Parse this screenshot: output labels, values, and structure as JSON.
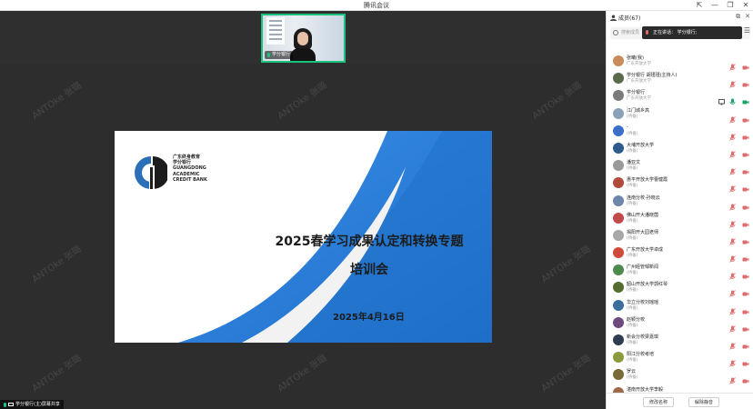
{
  "window": {
    "title": "腾讯会议"
  },
  "thumbnail": {
    "name": "学分银行"
  },
  "slide": {
    "logo_lines": [
      "广东终身教育",
      "学分银行",
      "GUANGDONG",
      "ACADEMIC",
      "CREDIT BANK"
    ],
    "title": "2025春学习成果认定和转换专题",
    "subtitle": "培训会",
    "date": "2025年4月16日"
  },
  "watermark": "ANTOke 张璐",
  "share_status": "学分银行(主)屏幕共享",
  "panel": {
    "title": "成员(67)",
    "search_placeholder": "搜索成员",
    "speaking": "正在讲话：  学分银行;",
    "members": [
      {
        "name": "张曦(我)",
        "status": "广东开放大学",
        "avatar": "#c98d5b",
        "cam": true
      },
      {
        "name": "学分银行 胡瑾瑾(主持人)",
        "status": "广东开放大学",
        "avatar": "#5b6a4a",
        "cam": true
      },
      {
        "name": "学分银行",
        "status": "广东开放大学",
        "avatar": "#7a7a7a",
        "cam": true,
        "share": true,
        "mic_on": true
      },
      {
        "name": "江门城乡高",
        "status": "(待备)",
        "avatar": "#8aa0b8",
        "cam": true
      },
      {
        "name": "-",
        "status": "(待备)",
        "avatar": "#3b6fc9",
        "cam": true
      },
      {
        "name": "大埔开放大学",
        "status": "(待备)",
        "avatar": "#2e5a8c",
        "cam": true
      },
      {
        "name": "潘亚文",
        "status": "(待备)",
        "avatar": "#9a9a9a",
        "cam": true
      },
      {
        "name": "惠平开放大学曹健霞",
        "status": "(待备)",
        "avatar": "#b04a3a",
        "cam": true
      },
      {
        "name": "连南分校-孙晓云",
        "status": "(待备)",
        "avatar": "#6b86a8",
        "cam": true
      },
      {
        "name": "佛山开大潘晓茵",
        "status": "(待备)",
        "avatar": "#c24a4a",
        "cam": true
      },
      {
        "name": "揭阳开大园老师",
        "status": "(待备)",
        "avatar": "#a8a8a8",
        "cam": true
      },
      {
        "name": "广东开放大学卓成",
        "status": "(待备)",
        "avatar": "#d04a3a",
        "cam": true
      },
      {
        "name": "广州经管邹新闻",
        "status": "(待备)",
        "avatar": "#4d8b4d",
        "cam": true
      },
      {
        "name": "韶山开放大学郭红琴",
        "status": "(待备)",
        "avatar": "#556b2f",
        "cam": true
      },
      {
        "name": "华立分校刘瑶瑶",
        "status": "(待备)",
        "avatar": "#3c6e9c",
        "cam": true
      },
      {
        "name": "赵颖分校",
        "status": "(待备)",
        "avatar": "#6d4a7a",
        "cam": true
      },
      {
        "name": "新会分校梁嘉琪",
        "status": "(待备)",
        "avatar": "#2f3b4f",
        "cam": true
      },
      {
        "name": "阳江分校考培",
        "status": "(待备)",
        "avatar": "#8b9a3c",
        "cam": true
      },
      {
        "name": "罗云",
        "status": "(待备)",
        "avatar": "#7a6a3a",
        "cam": true
      },
      {
        "name": "湛南开放大学李毅",
        "status": "(待备)",
        "avatar": "#9a6a4a",
        "cam": true
      }
    ],
    "footer": {
      "rename": "修改名称",
      "mute": "解除静音"
    }
  }
}
